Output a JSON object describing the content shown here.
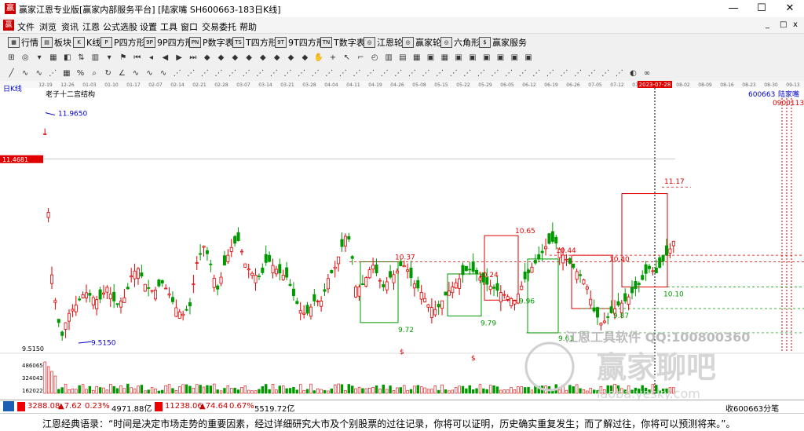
{
  "window": {
    "title": "赢家江恩专业版[赢家内部服务平台]  [陆家嘴  SH600663-183日K线]",
    "app_icon": "赢",
    "min": "—",
    "max": "☐",
    "close": "✕"
  },
  "menu": {
    "icon": "赢",
    "items": [
      "文件",
      "浏览",
      "资讯",
      "江恩",
      "公式选股",
      "设置",
      "工具",
      "窗口",
      "交易委托",
      "帮助"
    ],
    "mdi_min": "_",
    "mdi_max": "□",
    "mdi_close": "x"
  },
  "toolbar1": {
    "items": [
      {
        "icon": "▦",
        "label": "行情"
      },
      {
        "icon": "▤",
        "label": "板块"
      },
      {
        "icon": "K",
        "label": "K线"
      },
      {
        "icon": "P",
        "label": "P四方形"
      },
      {
        "icon": "9P",
        "label": "9P四方形"
      },
      {
        "icon": "PN",
        "label": "P数字表"
      },
      {
        "icon": "TS",
        "label": "T四方形"
      },
      {
        "icon": "9T",
        "label": "9T四方形"
      },
      {
        "icon": "TN",
        "label": "T数字表"
      },
      {
        "icon": "◎",
        "label": "江恩轮"
      },
      {
        "icon": "◎",
        "label": "赢家轮"
      },
      {
        "icon": "◎",
        "label": "六角形"
      },
      {
        "icon": "$",
        "label": "赢家服务"
      }
    ]
  },
  "toolbar2": {
    "icons": [
      "layout-icon",
      "target-icon",
      "dropdown-icon",
      "stack-icon",
      "color-icon",
      "sort-icon",
      "chart-icon",
      "dropdown-icon",
      "flag-icon",
      "first-icon",
      "prev-icon",
      "left-icon",
      "right-icon",
      "last-icon",
      "diamond-icon",
      "diamond-icon",
      "diamond-icon",
      "diamond-icon",
      "diamond-icon",
      "diamond-icon",
      "diamond-icon",
      "diamond-icon",
      "hand-icon",
      "cross-icon",
      "arrow-icon",
      "ruler-icon",
      "gauge-icon",
      "chart-icon",
      "chart-icon",
      "calendar-icon",
      "calc-icon",
      "grid-icon",
      "box-icon",
      "box-icon",
      "box-icon",
      "box-icon",
      "box-icon",
      "box-icon"
    ],
    "glyphs": [
      "⊞",
      "◎",
      "▾",
      "▦",
      "◧",
      "⇅",
      "▥",
      "▾",
      "⚑",
      "⏮",
      "◂",
      "◀",
      "▶",
      "⏭",
      "◆",
      "◆",
      "◆",
      "◆",
      "◆",
      "◆",
      "◆",
      "◆",
      "✋",
      "+",
      "↖",
      "⌐",
      "◴",
      "▥",
      "▤",
      "▦",
      "▣",
      "▦",
      "▣",
      "▣",
      "▣",
      "▣",
      "▣",
      "▣"
    ]
  },
  "toolbar3": {
    "icons": [
      "line-icon",
      "wave-icon",
      "wave-icon",
      "fan-icon",
      "grid-icon",
      "percent-icon",
      "zoom-icon",
      "cycle-icon",
      "angle-icon",
      "wave-icon",
      "wave-icon",
      "wave-icon",
      "fan-icon",
      "fan-icon",
      "fan-icon",
      "fan-icon",
      "fan-icon",
      "fan-icon",
      "fan-icon",
      "fan-icon",
      "fan-icon",
      "fan-icon",
      "fan-icon",
      "fan-icon",
      "fan-icon",
      "fan-icon",
      "fan-icon",
      "fan-icon",
      "fan-icon",
      "fan-icon",
      "fan-icon",
      "fan-icon",
      "fan-icon",
      "fan-icon",
      "fan-icon",
      "fan-icon",
      "fan-icon",
      "fan-icon",
      "fan-icon",
      "fan-icon",
      "fan-icon",
      "fan-icon",
      "fan-icon",
      "fan-icon",
      "fan-icon",
      "palette-icon",
      "link-icon"
    ],
    "glyphs": [
      "╱",
      "∿",
      "∿",
      "⋰",
      "▦",
      "%",
      "⌕",
      "↻",
      "∠",
      "∿",
      "∿",
      "∿",
      "⋰",
      "⋰",
      "⋰",
      "⋰",
      "⋰",
      "⋰",
      "⋰",
      "⋰",
      "⋰",
      "⋰",
      "⋰",
      "⋰",
      "⋰",
      "⋰",
      "⋰",
      "⋰",
      "⋰",
      "⋰",
      "⋰",
      "⋰",
      "⋰",
      "⋰",
      "⋰",
      "⋰",
      "⋰",
      "⋰",
      "⋰",
      "⋰",
      "⋰",
      "⋰",
      "⋰",
      "⋰",
      "⋰",
      "◐",
      "∞"
    ]
  },
  "chart": {
    "period_label": "日K线",
    "indicator_label": "老子十二宫结构",
    "stock_code": "600663",
    "stock_name": "陆家嘴",
    "right_value": "0900113",
    "cursor_date": "2023-07-28",
    "price_tag": "11.4681",
    "date_ticks": [
      "12-19",
      "12-26",
      "01-03",
      "01-10",
      "01-17",
      "02-07",
      "02-14",
      "02-21",
      "02-28",
      "03-07",
      "03-14",
      "03-21",
      "03-28",
      "04-04",
      "04-11",
      "04-19",
      "04-26",
      "05-08",
      "05-15",
      "05-22",
      "05-29",
      "06-05",
      "06-12",
      "06-19",
      "06-26",
      "07-05",
      "07-12",
      "07-19",
      "07-26",
      "08-02",
      "08-09",
      "08-16",
      "08-23",
      "08-30",
      "09-13"
    ],
    "annotations": [
      "11.9650",
      "9.5150",
      "10.37",
      "9.72",
      "9.79",
      "10.24",
      "10.65",
      "9.96",
      "10.44",
      "9.61",
      "9.87",
      "10.40",
      "10.10",
      "11.17",
      "$",
      "$"
    ],
    "axis_low": "9.5150",
    "volume_ticks": [
      "486065",
      "324043",
      "162022"
    ],
    "watermark_text": "江恩工具软件   QQ:100800360",
    "watermark_logo": "赢家聊吧",
    "watermark_url": "iaoba.yesky.com",
    "colors": {
      "up": "#e00000",
      "down": "#009900",
      "box_red": "#e00000",
      "box_green": "#009900",
      "label_blue": "#0000cc"
    }
  },
  "chart_data": {
    "type": "candlestick",
    "title": "",
    "symbol": "SH600663",
    "high_mark": 11.965,
    "low_mark": 9.515,
    "current_price_tag": 11.4681,
    "levels": [
      10.37,
      9.72,
      9.79,
      10.24,
      10.65,
      9.96,
      10.44,
      9.61,
      9.87,
      10.4,
      10.1,
      11.17
    ],
    "volume_ticks": [
      486065,
      324043,
      162022
    ]
  },
  "status": {
    "sh_index": "3288.08",
    "sh_change": "▲7.62",
    "sh_pct": "0.23%",
    "sh_amount": "4971.88亿",
    "sz_index": "11238.06",
    "sz_change": "▲74.64",
    "sz_pct": "0.67%",
    "sz_amount": "5519.72亿",
    "right_text": "收600663分笔"
  },
  "quote": {
    "text": "江恩经典语录：“时间是决定市场走势的重要因素，经过详细研究大市及个别股票的过往记录，你将可以证明，历史确实重复发生；而了解过往，你将可以预测将来。”。"
  }
}
